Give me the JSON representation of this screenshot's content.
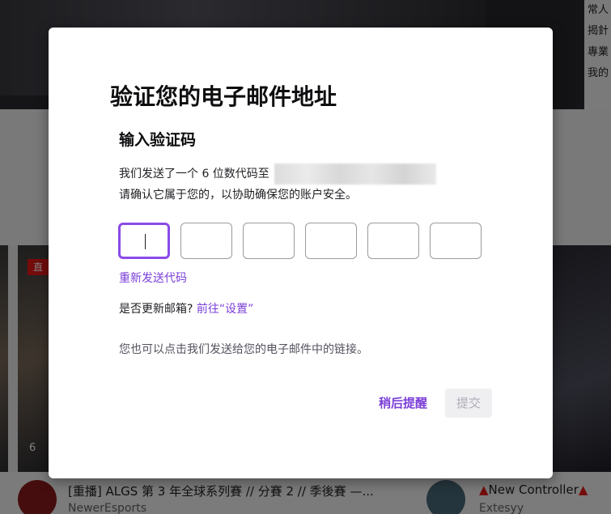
{
  "background": {
    "side_text": [
      "常人",
      "揭針",
      "專業",
      "我的"
    ],
    "live_badge": "直",
    "viewer_count": "6",
    "card1": {
      "title": "[重播] ALGS 第 3 年全球系列賽 // 分賽 2 // 季後賽 —...",
      "channel": "NewerEsports"
    },
    "card2": {
      "title": "New Controller",
      "channel": "Extesyy"
    }
  },
  "modal": {
    "title": "验证您的电子邮件地址",
    "section_title": "输入验证码",
    "description_line1": "我们发送了一个 6 位数代码至",
    "description_line2": "请确认它属于您的，以协助确保您的账户安全。",
    "code_digits": [
      "",
      "",
      "",
      "",
      "",
      ""
    ],
    "resend_label": "重新发送代码",
    "update_question": "是否更新邮箱?",
    "update_link": "前往“设置”",
    "note": "您也可以点击我们发送给您的电子邮件中的链接。",
    "later_label": "稍后提醒",
    "submit_label": "提交",
    "colors": {
      "accent": "#7b3fd9",
      "active_border": "#8a4be8",
      "disabled_bg": "#efeff1",
      "disabled_text": "#adadb8"
    }
  }
}
